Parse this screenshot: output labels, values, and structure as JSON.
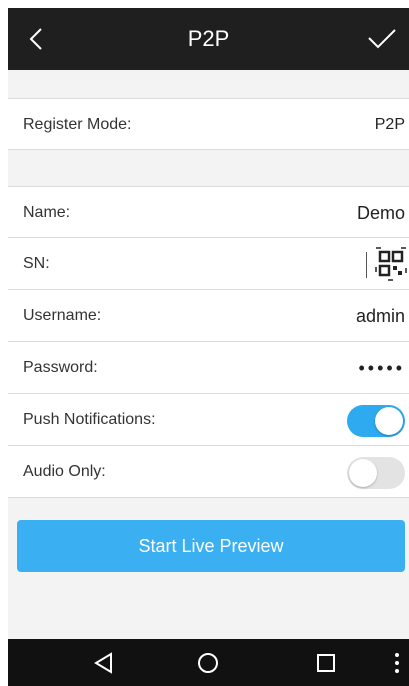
{
  "header": {
    "title": "P2P",
    "back_icon": "chevron-left-icon",
    "confirm_icon": "checkmark-icon"
  },
  "form": {
    "register_mode": {
      "label": "Register Mode:",
      "value": "P2P"
    },
    "name": {
      "label": "Name:",
      "value": "Demo"
    },
    "sn": {
      "label": "SN:",
      "value": "",
      "icon": "qr-scan-icon"
    },
    "username": {
      "label": "Username:",
      "value": "admin"
    },
    "password": {
      "label": "Password:",
      "value": "•••••"
    },
    "push_notifications": {
      "label": "Push Notifications:",
      "enabled": true
    },
    "audio_only": {
      "label": "Audio Only:",
      "enabled": false
    }
  },
  "actions": {
    "start_preview_label": "Start Live Preview"
  },
  "navbar": {
    "icons": [
      "back-triangle-icon",
      "home-circle-icon",
      "recents-square-icon",
      "more-dots-icon"
    ]
  },
  "colors": {
    "accent": "#3ab0f2",
    "topbar": "#1f1f1f",
    "navbar": "#111111",
    "background": "#f3f3f3"
  }
}
